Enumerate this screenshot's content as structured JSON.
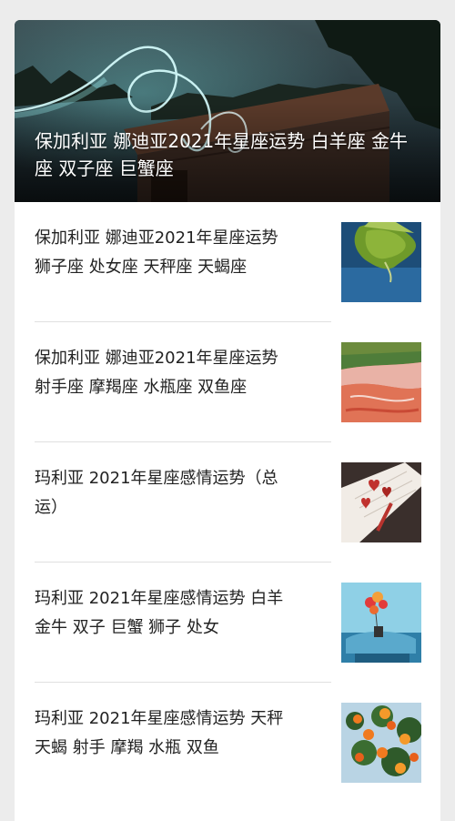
{
  "hero": {
    "title": "保加利亚 娜迪亚2021年星座运势 白羊座 金牛座 双子座 巨蟹座"
  },
  "articles": [
    {
      "title": "保加利亚 娜迪亚2021年星座运势 狮子座 处女座 天秤座 天蝎座",
      "thumbnail": "island-aerial-photo"
    },
    {
      "title": "保加利亚 娜迪亚2021年星座运势 射手座 摩羯座 水瓶座 双鱼座",
      "thumbnail": "red-lake-landscape-photo"
    },
    {
      "title": "玛利亚 2021年星座感情运势（总运）",
      "thumbnail": "book-hearts-photo"
    },
    {
      "title": "玛利亚 2021年星座感情运势 白羊 金牛 双子 巨蟹 狮子 处女",
      "thumbnail": "balloons-car-photo"
    },
    {
      "title": "玛利亚 2021年星座感情运势 天秤 天蝎 射手 摩羯 水瓶 双鱼",
      "thumbnail": "orange-flowers-photo"
    }
  ]
}
